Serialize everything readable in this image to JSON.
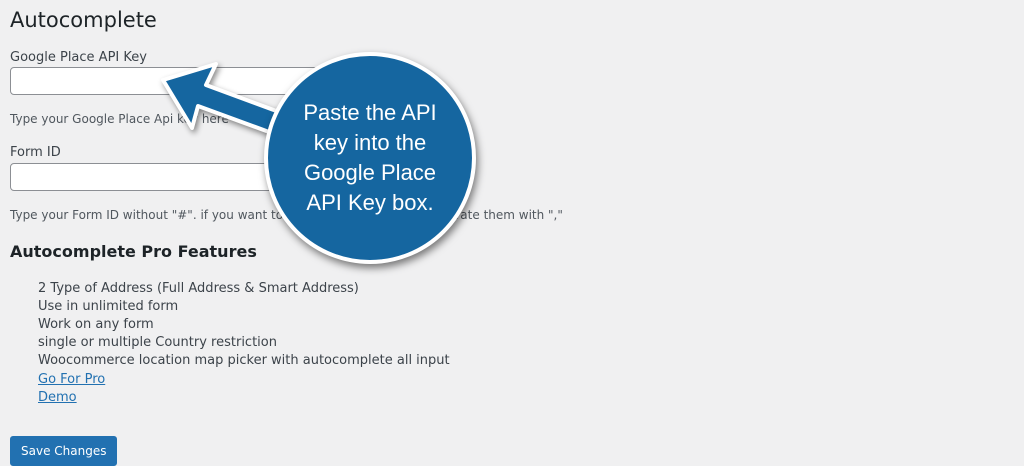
{
  "page": {
    "title": "Autocomplete"
  },
  "api_key": {
    "label": "Google Place API Key",
    "value": "",
    "help": "Type your Google Place Api key here"
  },
  "form_id": {
    "label": "Form ID",
    "value": "",
    "help": "Type your Form ID without \"#\". if you want to add multiple Form IDs, separate them with \",\""
  },
  "pro": {
    "title": "Autocomplete Pro Features",
    "features": [
      "2 Type of Address (Full Address & Smart Address)",
      "Use in unlimited form",
      "Work on any form",
      "single or multiple Country restriction",
      "Woocommerce location map picker with autocomplete all input"
    ],
    "links": [
      "Go For Pro",
      "Demo"
    ]
  },
  "actions": {
    "save_label": "Save Changes"
  },
  "callout": {
    "text": "Paste the API key into the Google Place API Key box.",
    "color": "#1566a0"
  }
}
